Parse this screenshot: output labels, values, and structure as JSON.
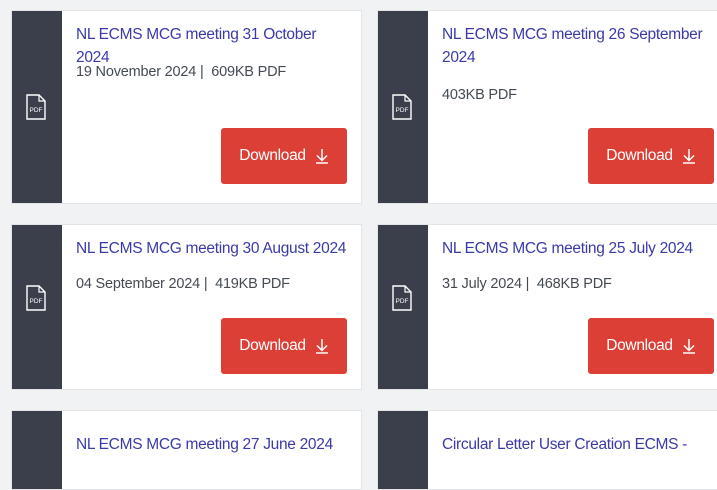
{
  "documents": [
    {
      "title": "NL ECMS MCG meeting 31 October 2024",
      "date": "19 November 2024",
      "separator": "|",
      "size": "609KB PDF",
      "download_label": "Download"
    },
    {
      "title": "NL ECMS MCG meeting 26 September 2024",
      "date": "",
      "separator": "",
      "size": "403KB PDF",
      "download_label": "Download"
    },
    {
      "title": "NL ECMS MCG meeting 30 August 2024",
      "date": "04 September 2024",
      "separator": "|",
      "size": "419KB PDF",
      "download_label": "Download"
    },
    {
      "title": "NL ECMS MCG meeting 25 July 2024",
      "date": "31 July 2024",
      "separator": "|",
      "size": "468KB PDF",
      "download_label": "Download"
    },
    {
      "title": "NL ECMS MCG meeting 27 June 2024",
      "date": "",
      "separator": "",
      "size": "",
      "download_label": ""
    },
    {
      "title": "Circular Letter User Creation ECMS -",
      "date": "",
      "separator": "",
      "size": "",
      "download_label": ""
    }
  ],
  "icons": {
    "file": "pdf-file-icon",
    "download": "download-arrow-icon"
  },
  "colors": {
    "title": "#3a3aa8",
    "sidebar": "#3a3f4b",
    "button": "#dc3f36",
    "meta": "#454b55"
  }
}
